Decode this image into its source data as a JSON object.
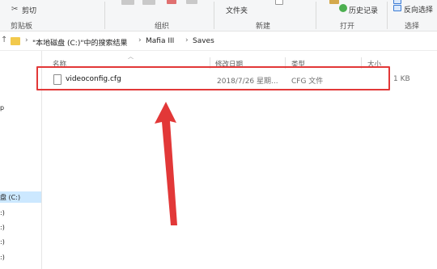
{
  "ribbon": {
    "cut_label": "剪切",
    "clipboard_group": "剪贴板",
    "organize_group": "组织",
    "folder_label": "文件夹",
    "new_group": "新建",
    "history_label": "历史记录",
    "open_group": "打开",
    "invert_label": "反向选择",
    "select_group": "选择"
  },
  "address": {
    "back_glyph": "↑",
    "chevron": "›",
    "breadcrumbs": [
      "\"本地磁盘 (C:)\"中的搜索结果",
      "Mafia III",
      "Saves"
    ]
  },
  "nav": {
    "items": [
      "p",
      "盘 (C:)",
      ":)",
      ":)",
      ":)",
      ":)"
    ]
  },
  "columns": {
    "name": "名称",
    "modified": "修改日期",
    "type": "类型",
    "size": "大小"
  },
  "files": [
    {
      "name": "videoconfig.cfg",
      "modified": "2018/7/26 星期...",
      "type": "CFG 文件",
      "size": "1 KB"
    }
  ],
  "colors": {
    "highlight": "#e23838",
    "arrow": "#e23838",
    "selection": "#cce8ff"
  }
}
